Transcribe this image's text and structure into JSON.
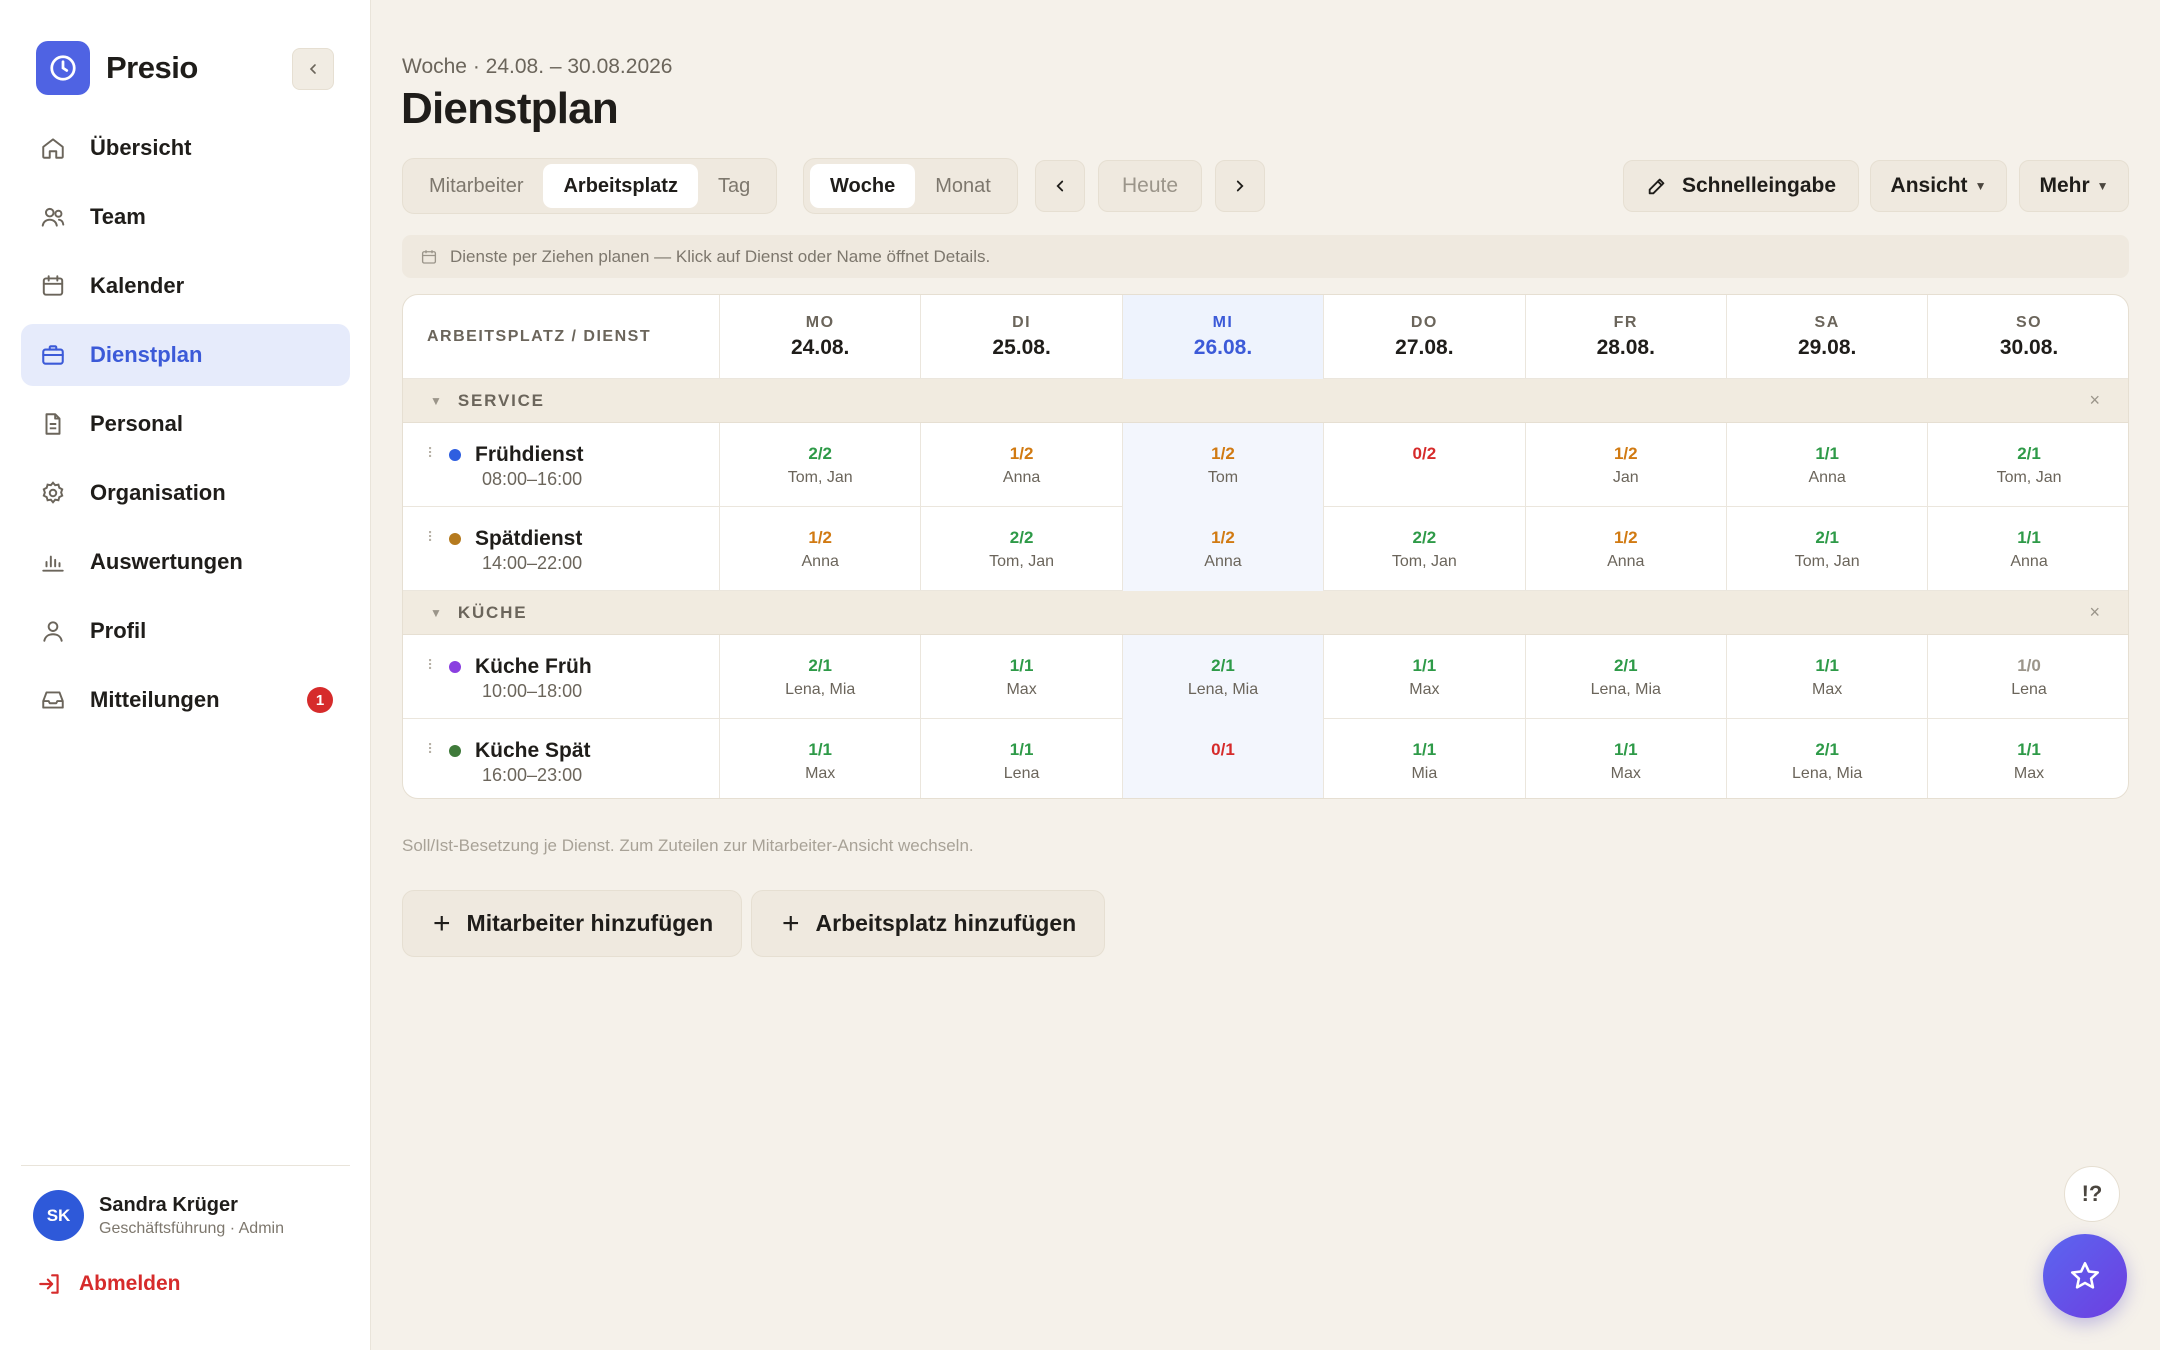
{
  "app": {
    "name": "Presio"
  },
  "sidebar": {
    "items": [
      {
        "label": "Übersicht",
        "icon": "home-icon"
      },
      {
        "label": "Team",
        "icon": "users-icon"
      },
      {
        "label": "Kalender",
        "icon": "calendar-icon"
      },
      {
        "label": "Dienstplan",
        "icon": "briefcase-icon",
        "active": true
      },
      {
        "label": "Personal",
        "icon": "document-icon"
      },
      {
        "label": "Organisation",
        "icon": "gear-icon"
      },
      {
        "label": "Auswertungen",
        "icon": "bar-chart-icon"
      },
      {
        "label": "Profil",
        "icon": "user-icon"
      },
      {
        "label": "Mitteilungen",
        "icon": "inbox-icon",
        "badge": "1"
      }
    ],
    "user": {
      "initials": "SK",
      "name": "Sandra Krüger",
      "role": "Geschäftsführung · Admin"
    },
    "logout_label": "Abmelden"
  },
  "header": {
    "subtitle": "Woche · 24.08. – 30.08.2026",
    "title": "Dienstplan"
  },
  "toolbar": {
    "view_tabs": [
      {
        "label": "Mitarbeiter"
      },
      {
        "label": "Arbeitsplatz",
        "active": true
      },
      {
        "label": "Tag"
      }
    ],
    "range_tabs": [
      {
        "label": "Woche",
        "active": true
      },
      {
        "label": "Monat"
      }
    ],
    "today_label": "Heute",
    "quick_entry_label": "Schnelleingabe",
    "view_label": "Ansicht",
    "more_label": "Mehr"
  },
  "hint": "Dienste per Ziehen planen — Klick auf Dienst oder Name öffnet Details.",
  "grid": {
    "first_column_header": "ARBEITSPLATZ / DIENST",
    "days": [
      {
        "name": "MO",
        "date": "24.08."
      },
      {
        "name": "DI",
        "date": "25.08."
      },
      {
        "name": "MI",
        "date": "26.08.",
        "today": true
      },
      {
        "name": "DO",
        "date": "27.08."
      },
      {
        "name": "FR",
        "date": "28.08."
      },
      {
        "name": "SA",
        "date": "29.08."
      },
      {
        "name": "SO",
        "date": "30.08."
      }
    ],
    "sections": [
      {
        "label": "SERVICE",
        "shifts": [
          {
            "name": "Frühdienst",
            "time": "08:00–16:00",
            "color": "#2f5fe0",
            "slots": [
              {
                "count": "2/2",
                "staff": "Tom, Jan",
                "status": "green"
              },
              {
                "count": "1/2",
                "staff": "Anna",
                "status": "orange"
              },
              {
                "count": "1/2",
                "staff": "Tom",
                "status": "orange"
              },
              {
                "count": "0/2",
                "staff": "",
                "status": "red"
              },
              {
                "count": "1/2",
                "staff": "Jan",
                "status": "orange"
              },
              {
                "count": "1/1",
                "staff": "Anna",
                "status": "green"
              },
              {
                "count": "2/1",
                "staff": "Tom, Jan",
                "status": "green"
              }
            ]
          },
          {
            "name": "Spätdienst",
            "time": "14:00–22:00",
            "color": "#b57a1e",
            "slots": [
              {
                "count": "1/2",
                "staff": "Anna",
                "status": "orange"
              },
              {
                "count": "2/2",
                "staff": "Tom, Jan",
                "status": "green"
              },
              {
                "count": "1/2",
                "staff": "Anna",
                "status": "orange"
              },
              {
                "count": "2/2",
                "staff": "Tom, Jan",
                "status": "green"
              },
              {
                "count": "1/2",
                "staff": "Anna",
                "status": "orange"
              },
              {
                "count": "2/1",
                "staff": "Tom, Jan",
                "status": "green"
              },
              {
                "count": "1/1",
                "staff": "Anna",
                "status": "green"
              }
            ]
          }
        ]
      },
      {
        "label": "KÜCHE",
        "shifts": [
          {
            "name": "Küche Früh",
            "time": "10:00–18:00",
            "color": "#8a3fe0",
            "slots": [
              {
                "count": "2/1",
                "staff": "Lena, Mia",
                "status": "green"
              },
              {
                "count": "1/1",
                "staff": "Max",
                "status": "green"
              },
              {
                "count": "2/1",
                "staff": "Lena, Mia",
                "status": "green"
              },
              {
                "count": "1/1",
                "staff": "Max",
                "status": "green"
              },
              {
                "count": "2/1",
                "staff": "Lena, Mia",
                "status": "green"
              },
              {
                "count": "1/1",
                "staff": "Max",
                "status": "green"
              },
              {
                "count": "1/0",
                "staff": "Lena",
                "status": "grey"
              }
            ]
          },
          {
            "name": "Küche Spät",
            "time": "16:00–23:00",
            "color": "#3f7a3a",
            "slots": [
              {
                "count": "1/1",
                "staff": "Max",
                "status": "green"
              },
              {
                "count": "1/1",
                "staff": "Lena",
                "status": "green"
              },
              {
                "count": "0/1",
                "staff": "",
                "status": "red"
              },
              {
                "count": "1/1",
                "staff": "Mia",
                "status": "green"
              },
              {
                "count": "1/1",
                "staff": "Max",
                "status": "green"
              },
              {
                "count": "2/1",
                "staff": "Lena, Mia",
                "status": "green"
              },
              {
                "count": "1/1",
                "staff": "Max",
                "status": "green"
              }
            ]
          }
        ]
      }
    ]
  },
  "footnote": "Soll/Ist-Besetzung je Dienst. Zum Zuteilen zur Mitarbeiter-Ansicht wechseln.",
  "actions": {
    "add_employee_label": "Mitarbeiter hinzufügen",
    "add_workplace_label": "Arbeitsplatz hinzufügen"
  },
  "help_label": "!?",
  "colors": {
    "accent": "#3c5ad8",
    "ok": "#2e9a48",
    "warn": "#d17a12",
    "error": "#d62b2b"
  }
}
